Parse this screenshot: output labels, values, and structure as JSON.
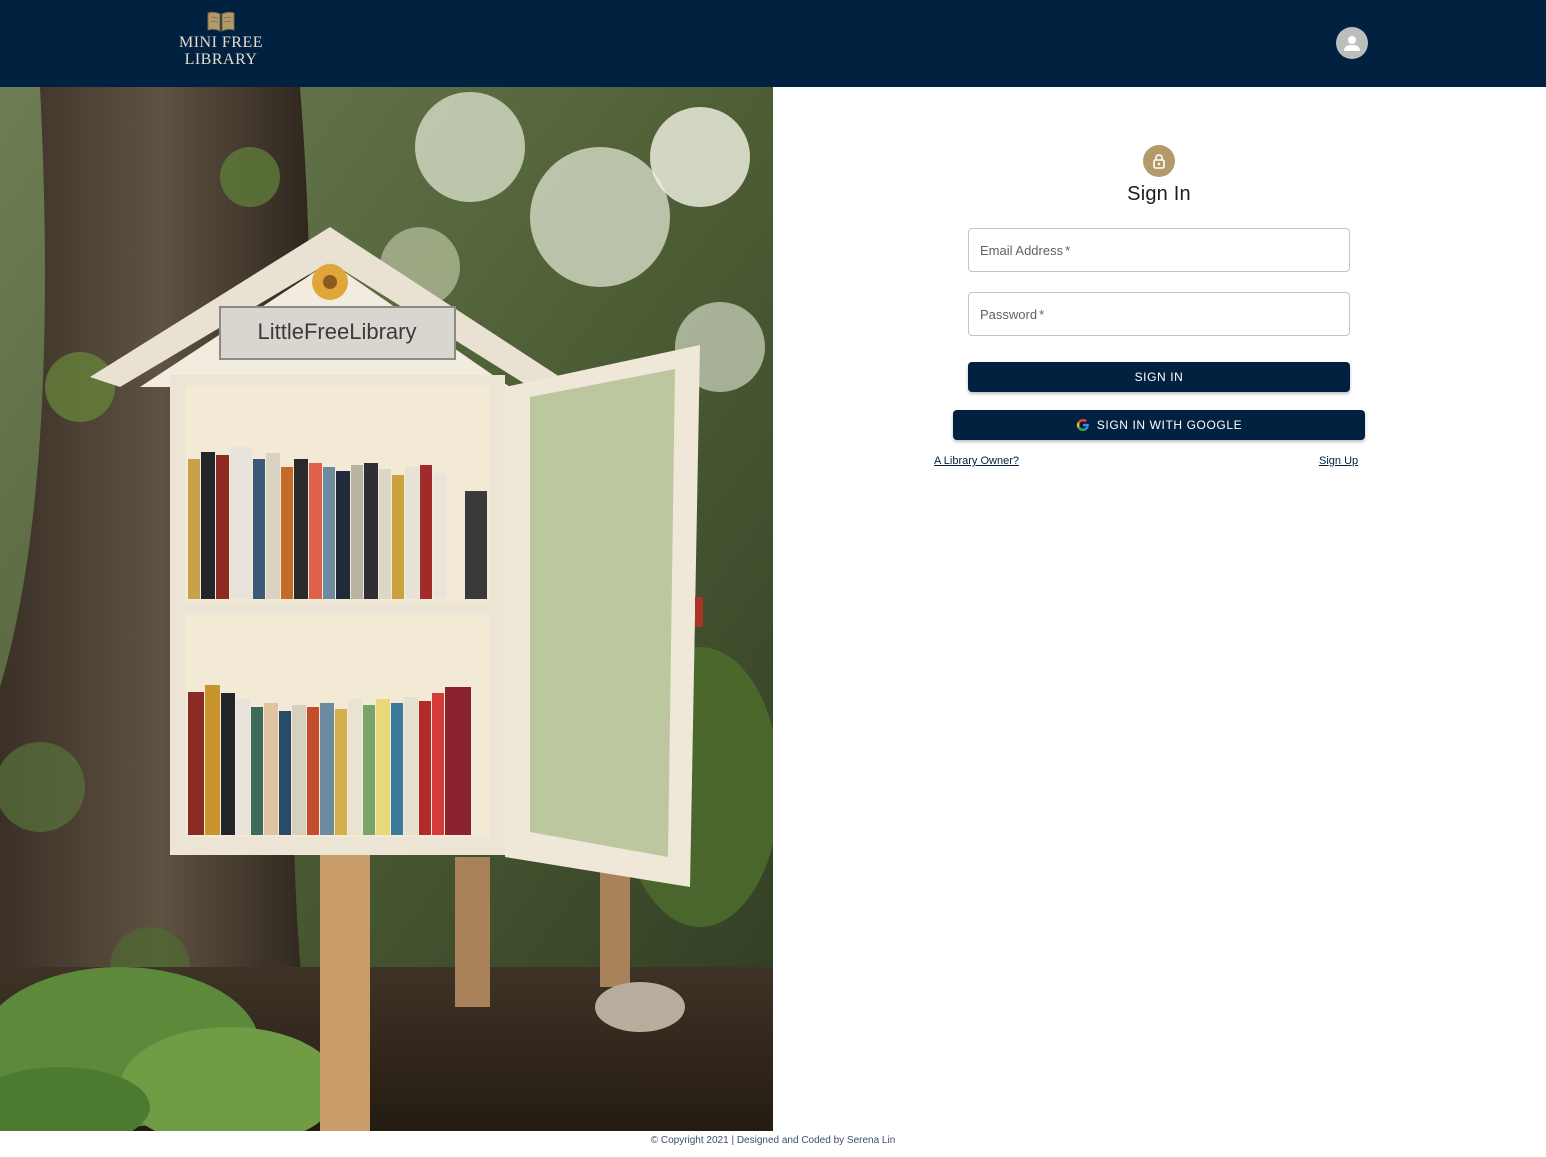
{
  "header": {
    "logo_line1": "MINI FREE",
    "logo_line2": "LIBRARY",
    "logo_icon": "open-book-icon",
    "avatar_icon": "person-icon",
    "bg_color": "#012141"
  },
  "hero": {
    "image_desc_icon": "little-free-library-photo"
  },
  "signin": {
    "icon": "lock-icon",
    "title": "Sign In",
    "email_label": "Email Address",
    "email_value": "",
    "password_label": "Password",
    "password_value": "",
    "required_mark": "*",
    "signin_button": "SIGN IN",
    "google_button": "SIGN IN WITH GOOGLE",
    "owner_link": "A Library Owner?",
    "signup_link": "Sign Up",
    "accent_color": "#b39a6a"
  },
  "footer": {
    "text": "© Copyright 2021 | Designed and Coded by Serena Lin"
  }
}
